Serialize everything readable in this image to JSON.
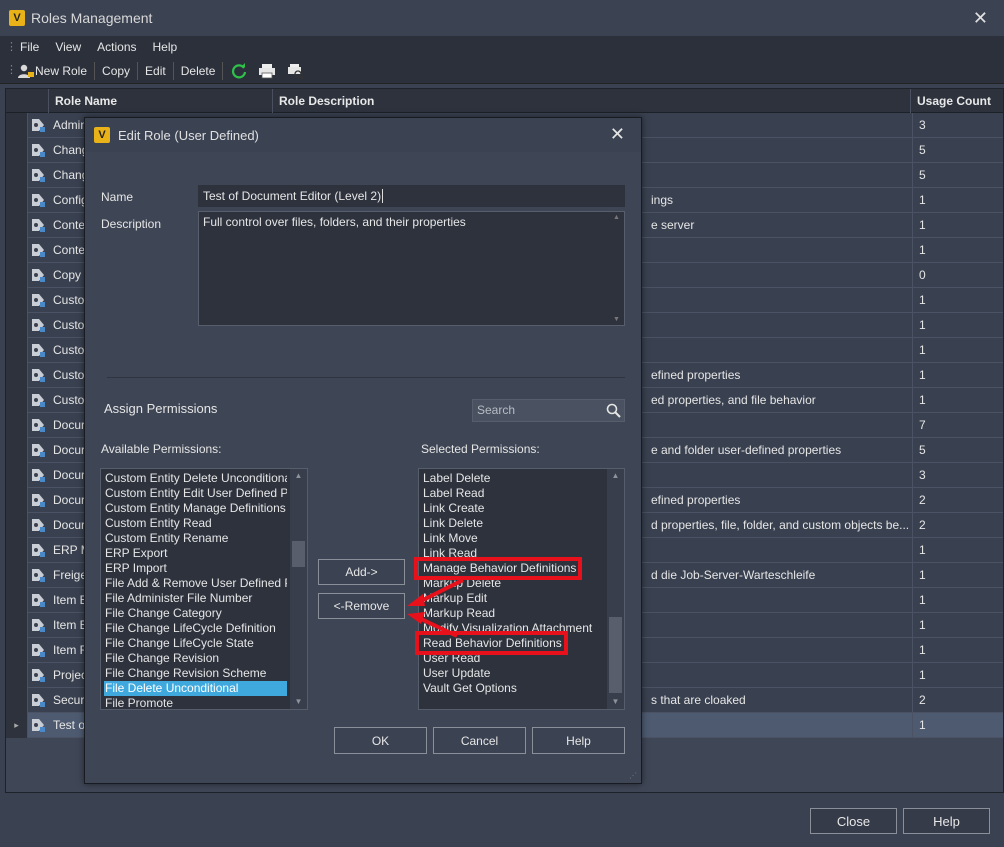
{
  "window": {
    "title": "Roles Management",
    "app_icon_letter": "V",
    "close_glyph": "✕"
  },
  "menu": [
    "File",
    "View",
    "Actions",
    "Help"
  ],
  "toolbar": {
    "new_role": "New Role",
    "copy": "Copy",
    "edit": "Edit",
    "delete": "Delete"
  },
  "grid": {
    "headers": {
      "name": "Role Name",
      "description": "Role Description",
      "usage": "Usage Count"
    },
    "rows": [
      {
        "name": "Admin",
        "desc": "",
        "count": "3"
      },
      {
        "name": "Chang",
        "desc": "",
        "count": "5"
      },
      {
        "name": "Chang",
        "desc": "",
        "count": "5"
      },
      {
        "name": "Config",
        "desc": "ings",
        "count": "1"
      },
      {
        "name": "Conte",
        "desc": "e server",
        "count": "1"
      },
      {
        "name": "Conte",
        "desc": "",
        "count": "1"
      },
      {
        "name": "Copy",
        "desc": "",
        "count": "0"
      },
      {
        "name": "Custo",
        "desc": "",
        "count": "1"
      },
      {
        "name": "Custo",
        "desc": "",
        "count": "1"
      },
      {
        "name": "Custo",
        "desc": "",
        "count": "1"
      },
      {
        "name": "Custo",
        "desc": "efined properties",
        "count": "1"
      },
      {
        "name": "Custo",
        "desc": "ed properties, and file behavior",
        "count": "1"
      },
      {
        "name": "Docur",
        "desc": "",
        "count": "7"
      },
      {
        "name": "Docur",
        "desc": "e and folder user-defined properties",
        "count": "5"
      },
      {
        "name": "Docur",
        "desc": "",
        "count": "3"
      },
      {
        "name": "Docur",
        "desc": "efined properties",
        "count": "2"
      },
      {
        "name": "Docur",
        "desc": "d properties, file, folder, and custom objects be...",
        "count": "2"
      },
      {
        "name": "ERP M",
        "desc": "",
        "count": "1"
      },
      {
        "name": "Freige",
        "desc": "d die Job-Server-Warteschleife",
        "count": "1"
      },
      {
        "name": "Item E",
        "desc": "",
        "count": "1"
      },
      {
        "name": "Item E",
        "desc": "",
        "count": "1"
      },
      {
        "name": "Item R",
        "desc": "",
        "count": "1"
      },
      {
        "name": "Projec",
        "desc": "",
        "count": "1"
      },
      {
        "name": "Securi",
        "desc": "s that are cloaked",
        "count": "2"
      },
      {
        "name": "Test o",
        "desc": "",
        "count": "1"
      }
    ]
  },
  "buttons": {
    "close": "Close",
    "help": "Help"
  },
  "dialog": {
    "title": "Edit Role (User Defined)",
    "name_label": "Name",
    "name_value": "Test of Document Editor (Level 2)",
    "description_label": "Description",
    "description_value": "Full control over files, folders, and their properties",
    "assign_heading": "Assign Permissions",
    "search_placeholder": "Search",
    "available_label": "Available Permissions:",
    "selected_label": "Selected Permissions:",
    "available": [
      "Custom Entity Delete Unconditional",
      "Custom Entity Edit User Defined Properties",
      "Custom Entity Manage Definitions",
      "Custom Entity Read",
      "Custom Entity Rename",
      "ERP Export",
      "ERP Import",
      "File Add & Remove User Defined Properties",
      "File Administer File Number",
      "File Change Category",
      "File Change LifeCycle Definition",
      "File Change LifeCycle State",
      "File Change Revision",
      "File Change Revision Scheme",
      "File Delete Unconditional",
      "File Promote"
    ],
    "available_selected_index": 14,
    "selected": [
      "Label Delete",
      "Label Read",
      "Link Create",
      "Link Delete",
      "Link Move",
      "Link Read",
      "Manage Behavior Definitions",
      "Markup Delete",
      "Markup Edit",
      "Markup Read",
      "Modify Visualization Attachment",
      "Read Behavior Definitions",
      "User Read",
      "User Update",
      "Vault Get Options"
    ],
    "add_button": "Add->",
    "remove_button": "<-Remove",
    "ok_button": "OK",
    "cancel_button": "Cancel",
    "help_button": "Help"
  },
  "colors": {
    "highlight": "#e8101b",
    "selection": "#3fa9de",
    "app_icon": "#e8b218"
  }
}
